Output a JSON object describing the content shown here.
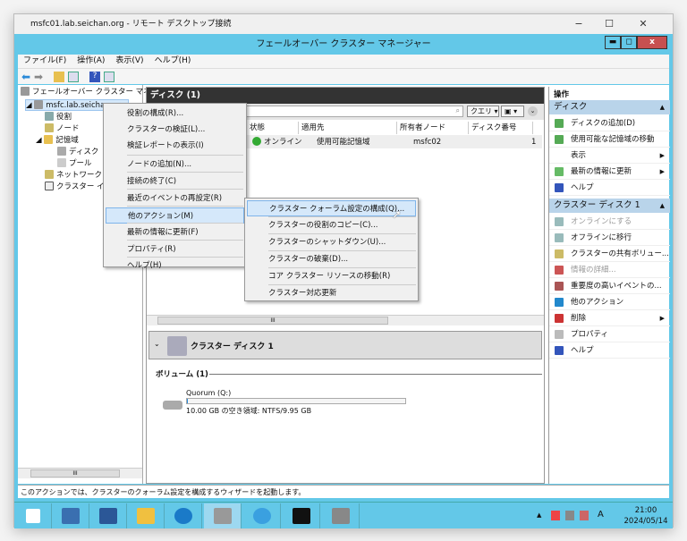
{
  "rdp": {
    "title": "msfc01.lab.seichan.org - リモート デスクトップ接続",
    "min": "−",
    "max": "☐",
    "close": "✕"
  },
  "app": {
    "title": "フェールオーバー クラスター マネージャー",
    "min": "▬",
    "max": "◻",
    "close": "x"
  },
  "menubar": [
    "ファイル(F)",
    "操作(A)",
    "表示(V)",
    "ヘルプ(H)"
  ],
  "tree": {
    "root": "フェールオーバー クラスター マネージ",
    "cluster": "msfc.lab.seichan.org",
    "items": [
      "役割",
      "ノード",
      "記憶域",
      "ディスク",
      "プール",
      "ネットワーク",
      "クラスター イベ"
    ]
  },
  "main": {
    "header": "ディスク (1)",
    "query": "クエリ",
    "columns": [
      "状態",
      "適用先",
      "所有者ノード",
      "ディスク番号"
    ],
    "row": {
      "status": "オンライン",
      "applies": "使用可能記憶域",
      "owner": "msfc02",
      "disk_no": "1"
    },
    "detail_title": "クラスター ディスク 1",
    "volumes_label": "ボリューム (1)",
    "volume_name": "Quorum (Q:)",
    "volume_used_fraction": 0.005,
    "volume_free": "10.00 GB の空き領域: NTFS/9.95 GB",
    "scroll": "III"
  },
  "context_menu": [
    "役割の構成(R)...",
    "クラスターの検証(L)...",
    "検証レポートの表示(I)",
    "ノードの追加(N)...",
    "接続の終了(C)",
    "最近のイベントの再設定(R)",
    "他のアクション(M)",
    "最新の情報に更新(F)",
    "プロパティ(R)",
    "ヘルプ(H)"
  ],
  "submenu": [
    "クラスター クォーラム設定の構成(Q)...",
    "クラスターの役割のコピー(C)...",
    "クラスターのシャットダウン(U)...",
    "クラスターの破棄(D)...",
    "コア クラスター リソースの移動(R)",
    "クラスター対応更新"
  ],
  "actions": {
    "title": "操作",
    "section1": "ディスク",
    "items1": [
      "ディスクの追加(D)",
      "使用可能な記憶域の移動",
      "表示",
      "最新の情報に更新",
      "ヘルプ"
    ],
    "section2": "クラスター ディスク 1",
    "items2": [
      "オンラインにする",
      "オフラインに移行",
      "クラスターの共有ボリュー...",
      "情報の詳細...",
      "重要度の高いイベントの...",
      "他のアクション",
      "削除",
      "プロパティ",
      "ヘルプ"
    ]
  },
  "status": "このアクションでは、クラスターのクォーラム設定を構成するウィザードを起動します。",
  "taskbar": {
    "time": "21:00",
    "date": "2024/05/14",
    "ime": "A"
  }
}
